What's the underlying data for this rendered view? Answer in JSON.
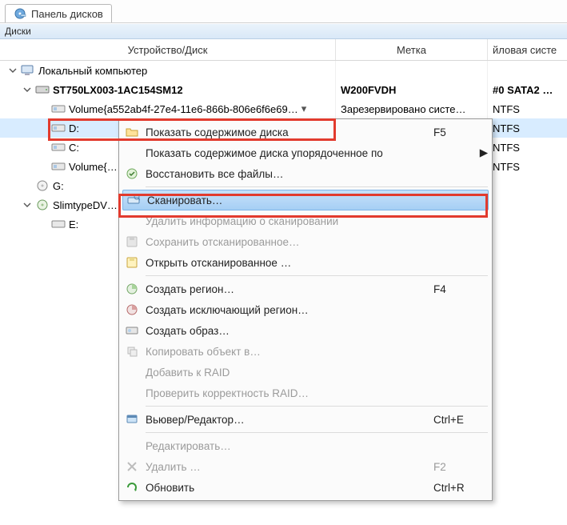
{
  "colors": {
    "highlight_row": "#d8ecff",
    "menu_highlight": "#a6cff4",
    "red_box": "#e23b2e"
  },
  "tab": {
    "label": "Панель дисков"
  },
  "subheader": {
    "label": "Диски"
  },
  "columns": {
    "c0": "Устройство/Диск",
    "c1": "Метка",
    "c2": "йловая систе"
  },
  "tree": {
    "root": {
      "label": "Локальный компьютер",
      "children": [
        {
          "label": "ST750LX003-1AC154SM12",
          "bold": true,
          "col1": "W200FVDH",
          "col1_bold": true,
          "col2": "#0 SATA2 …",
          "col2_bold": true,
          "children": [
            {
              "label": "Volume{a552ab4f-27e4-11e6-866b-806e6f6e69…",
              "col1": "Зарезервировано систе…",
              "col2": "NTFS"
            },
            {
              "label": "D:",
              "col1": "",
              "col2": "NTFS",
              "highlighted": true
            },
            {
              "label": "C:",
              "col1": "",
              "col2": "NTFS"
            },
            {
              "label": "Volume{…",
              "col1": "",
              "col2": "NTFS"
            }
          ]
        },
        {
          "label": "G:",
          "col1": "",
          "col2": ""
        },
        {
          "label": "SlimtypeDV…",
          "open": true,
          "children": [
            {
              "label": "E:",
              "col1": "",
              "col2": ""
            }
          ]
        }
      ]
    }
  },
  "context_menu": {
    "items": [
      {
        "kind": "item",
        "label": "Показать содержимое диска",
        "shortcut": "F5",
        "icon": "folder-open"
      },
      {
        "kind": "item",
        "label": "Показать содержимое диска упорядоченное по",
        "submenu": true
      },
      {
        "kind": "item",
        "label": "Восстановить все файлы…",
        "icon": "recover"
      },
      {
        "kind": "sep"
      },
      {
        "kind": "item",
        "label": "Сканировать…",
        "icon": "scan",
        "selected": true
      },
      {
        "kind": "item",
        "label": "Удалить информацию о сканировании",
        "disabled": true
      },
      {
        "kind": "item",
        "label": "Сохранить отсканированное…",
        "disabled": true,
        "icon": "save-disk"
      },
      {
        "kind": "item",
        "label": "Открыть отсканированное …",
        "icon": "open-disk"
      },
      {
        "kind": "sep"
      },
      {
        "kind": "item",
        "label": "Создать регион…",
        "shortcut": "F4",
        "icon": "region"
      },
      {
        "kind": "item",
        "label": "Создать исключающий регион…",
        "icon": "region-excl"
      },
      {
        "kind": "item",
        "label": "Создать образ…",
        "icon": "image"
      },
      {
        "kind": "item",
        "label": "Копировать объект в…",
        "disabled": true,
        "icon": "copy"
      },
      {
        "kind": "item",
        "label": "Добавить к RAID",
        "disabled": true
      },
      {
        "kind": "item",
        "label": "Проверить корректность RAID…",
        "disabled": true
      },
      {
        "kind": "sep"
      },
      {
        "kind": "item",
        "label": "Вьювер/Редактор…",
        "shortcut": "Ctrl+E",
        "icon": "viewer"
      },
      {
        "kind": "sep"
      },
      {
        "kind": "item",
        "label": "Редактировать…",
        "disabled": true
      },
      {
        "kind": "item",
        "label": "Удалить …",
        "shortcut": "F2",
        "disabled": true,
        "icon": "delete"
      },
      {
        "kind": "item",
        "label": "Обновить",
        "shortcut": "Ctrl+R",
        "icon": "refresh"
      }
    ]
  }
}
